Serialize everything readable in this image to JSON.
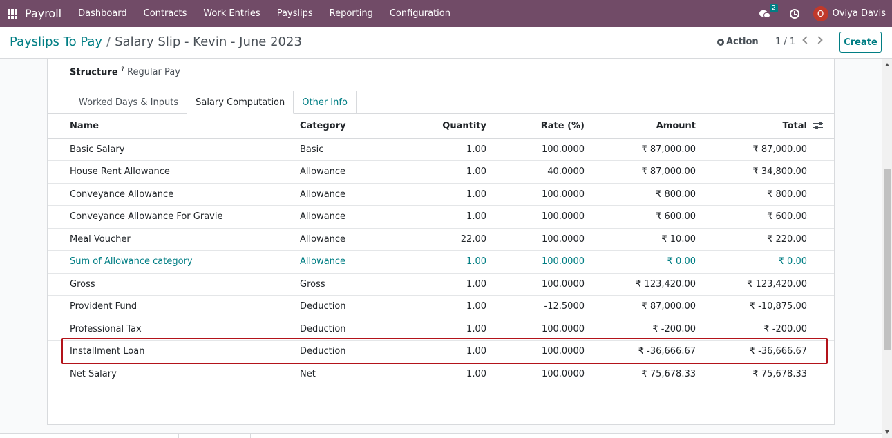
{
  "navbar": {
    "app_name": "Payroll",
    "menu": [
      "Dashboard",
      "Contracts",
      "Work Entries",
      "Payslips",
      "Reporting",
      "Configuration"
    ],
    "chat_count": "2",
    "user_initial": "O",
    "user_name": "Oviya Davis",
    "color": "#714b67"
  },
  "control_panel": {
    "breadcrumb_parent": "Payslips To Pay",
    "breadcrumb_separator": "/",
    "breadcrumb_current": "Salary Slip - Kevin - June 2023",
    "action_label": "Action",
    "pager": "1 / 1",
    "create_label": "Create"
  },
  "form": {
    "structure_label": "Structure",
    "structure_help": "?",
    "structure_value": "Regular Pay",
    "tabs": [
      "Worked Days & Inputs",
      "Salary Computation",
      "Other Info"
    ],
    "active_tab": "Salary Computation"
  },
  "table": {
    "headers": {
      "name": "Name",
      "category": "Category",
      "quantity": "Quantity",
      "rate": "Rate (%)",
      "amount": "Amount",
      "total": "Total"
    },
    "rows": [
      {
        "name": "Basic Salary",
        "category": "Basic",
        "quantity": "1.00",
        "rate": "100.0000",
        "amount": "₹ 87,000.00",
        "total": "₹ 87,000.00"
      },
      {
        "name": "House Rent Allowance",
        "category": "Allowance",
        "quantity": "1.00",
        "rate": "40.0000",
        "amount": "₹ 87,000.00",
        "total": "₹ 34,800.00"
      },
      {
        "name": "Conveyance Allowance",
        "category": "Allowance",
        "quantity": "1.00",
        "rate": "100.0000",
        "amount": "₹ 800.00",
        "total": "₹ 800.00"
      },
      {
        "name": "Conveyance Allowance For Gravie",
        "category": "Allowance",
        "quantity": "1.00",
        "rate": "100.0000",
        "amount": "₹ 600.00",
        "total": "₹ 600.00"
      },
      {
        "name": "Meal Voucher",
        "category": "Allowance",
        "quantity": "22.00",
        "rate": "100.0000",
        "amount": "₹ 10.00",
        "total": "₹ 220.00"
      },
      {
        "name": "Sum of Allowance category",
        "category": "Allowance",
        "quantity": "1.00",
        "rate": "100.0000",
        "amount": "₹ 0.00",
        "total": "₹ 0.00"
      },
      {
        "name": "Gross",
        "category": "Gross",
        "quantity": "1.00",
        "rate": "100.0000",
        "amount": "₹ 123,420.00",
        "total": "₹ 123,420.00"
      },
      {
        "name": "Provident Fund",
        "category": "Deduction",
        "quantity": "1.00",
        "rate": "-12.5000",
        "amount": "₹ 87,000.00",
        "total": "₹ -10,875.00"
      },
      {
        "name": "Professional Tax",
        "category": "Deduction",
        "quantity": "1.00",
        "rate": "100.0000",
        "amount": "₹ -200.00",
        "total": "₹ -200.00"
      },
      {
        "name": "Installment Loan",
        "category": "Deduction",
        "quantity": "1.00",
        "rate": "100.0000",
        "amount": "₹ -36,666.67",
        "total": "₹ -36,666.67"
      },
      {
        "name": "Net Salary",
        "category": "Net",
        "quantity": "1.00",
        "rate": "100.0000",
        "amount": "₹ 75,678.33",
        "total": "₹ 75,678.33"
      }
    ],
    "highlighted_row": "Sum of Allowance category",
    "outlined_row": "Installment Loan"
  },
  "colors": {
    "brand": "#714b67",
    "link": "#017e84",
    "annotation_box": "#b3131a"
  }
}
